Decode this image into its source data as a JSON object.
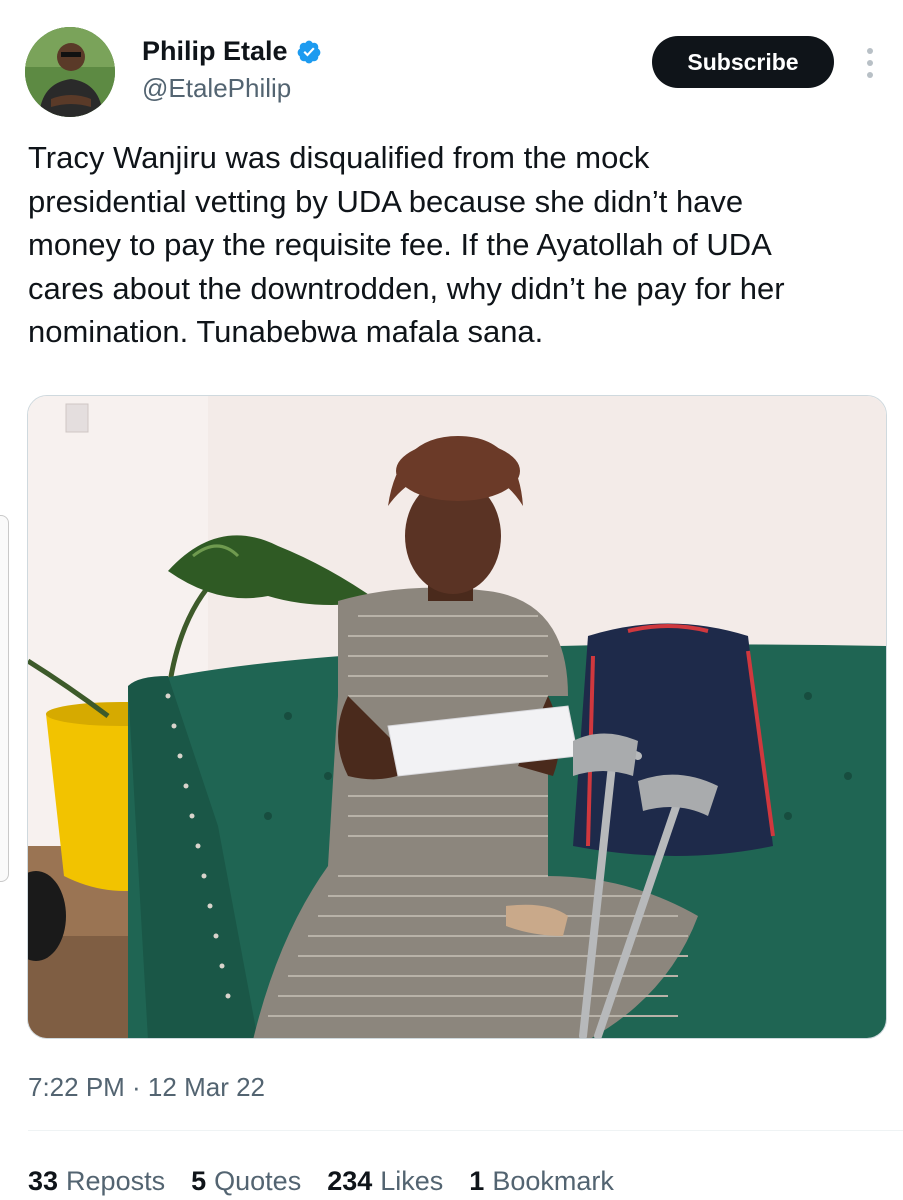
{
  "author": {
    "name": "Philip Etale",
    "handle": "@EtalePhilip",
    "verified_icon": "verified-badge-icon"
  },
  "actions": {
    "subscribe_label": "Subscribe",
    "more_icon": "more-vertical-icon"
  },
  "tweet": {
    "text": "Tracy Wanjiru was disqualified from the mock\npresidential vetting by UDA because she didn’t have\nmoney to pay the requisite fee. If the Ayatollah of UDA\ncares about the downtrodden, why didn’t he pay for her\nnomination. Tunabebwa mafala sana.",
    "timestamp": "7:22 PM · 12 Mar 22"
  },
  "stats": [
    {
      "count": "33",
      "label": "Reposts"
    },
    {
      "count": "5",
      "label": "Quotes"
    },
    {
      "count": "234",
      "label": "Likes"
    },
    {
      "count": "1",
      "label": "Bookmark"
    }
  ],
  "colors": {
    "text_primary": "#0f1419",
    "text_secondary": "#536471",
    "verified_blue": "#1d9bf0",
    "button_dark": "#0f1419",
    "sofa_green": "#1f6553",
    "pot_yellow": "#f2c300"
  }
}
